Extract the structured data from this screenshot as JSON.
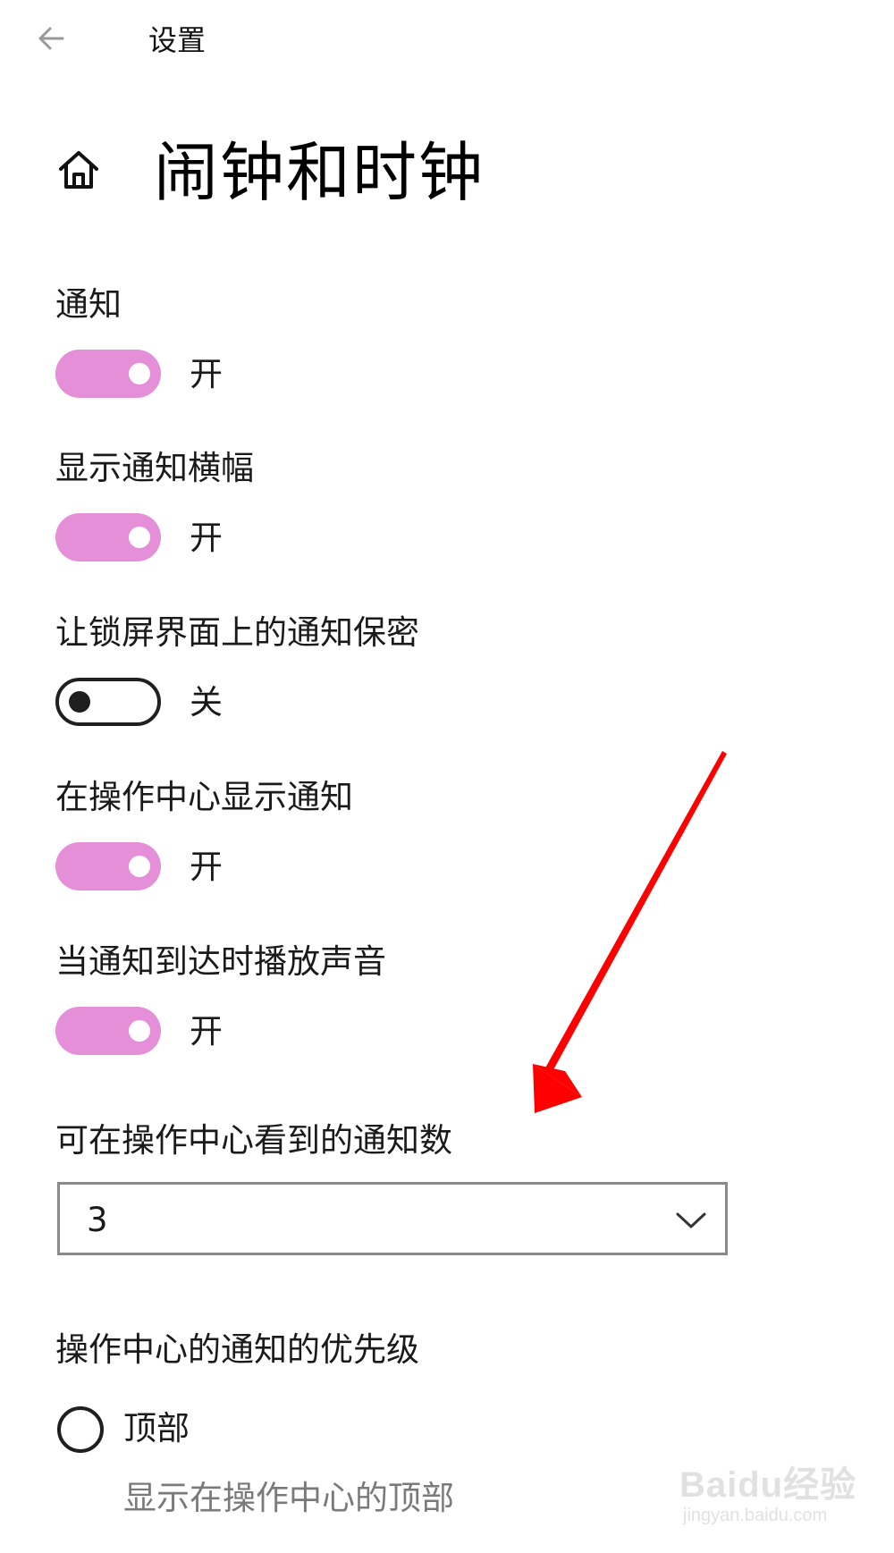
{
  "header": {
    "app_title": "设置",
    "back_icon": "back-arrow-icon"
  },
  "page": {
    "home_icon": "home-icon",
    "title": "闹钟和时钟"
  },
  "settings": [
    {
      "label": "通知",
      "state": "开",
      "on": true
    },
    {
      "label": "显示通知横幅",
      "state": "开",
      "on": true
    },
    {
      "label": "让锁屏界面上的通知保密",
      "state": "关",
      "on": false
    },
    {
      "label": "在操作中心显示通知",
      "state": "开",
      "on": true
    },
    {
      "label": "当通知到达时播放声音",
      "state": "开",
      "on": true
    }
  ],
  "notification_count": {
    "label": "可在操作中心看到的通知数",
    "selected": "3"
  },
  "priority": {
    "label": "操作中心的通知的优先级",
    "option_label": "顶部",
    "option_desc": "显示在操作中心的顶部"
  },
  "annotation": {
    "arrow_color": "#ff0000"
  },
  "watermark": {
    "brand": "Baidu经验",
    "url": "jingyan.baidu.com"
  },
  "colors": {
    "toggle_on": "#e48fd7",
    "toggle_off_border": "#1f1f1f"
  }
}
